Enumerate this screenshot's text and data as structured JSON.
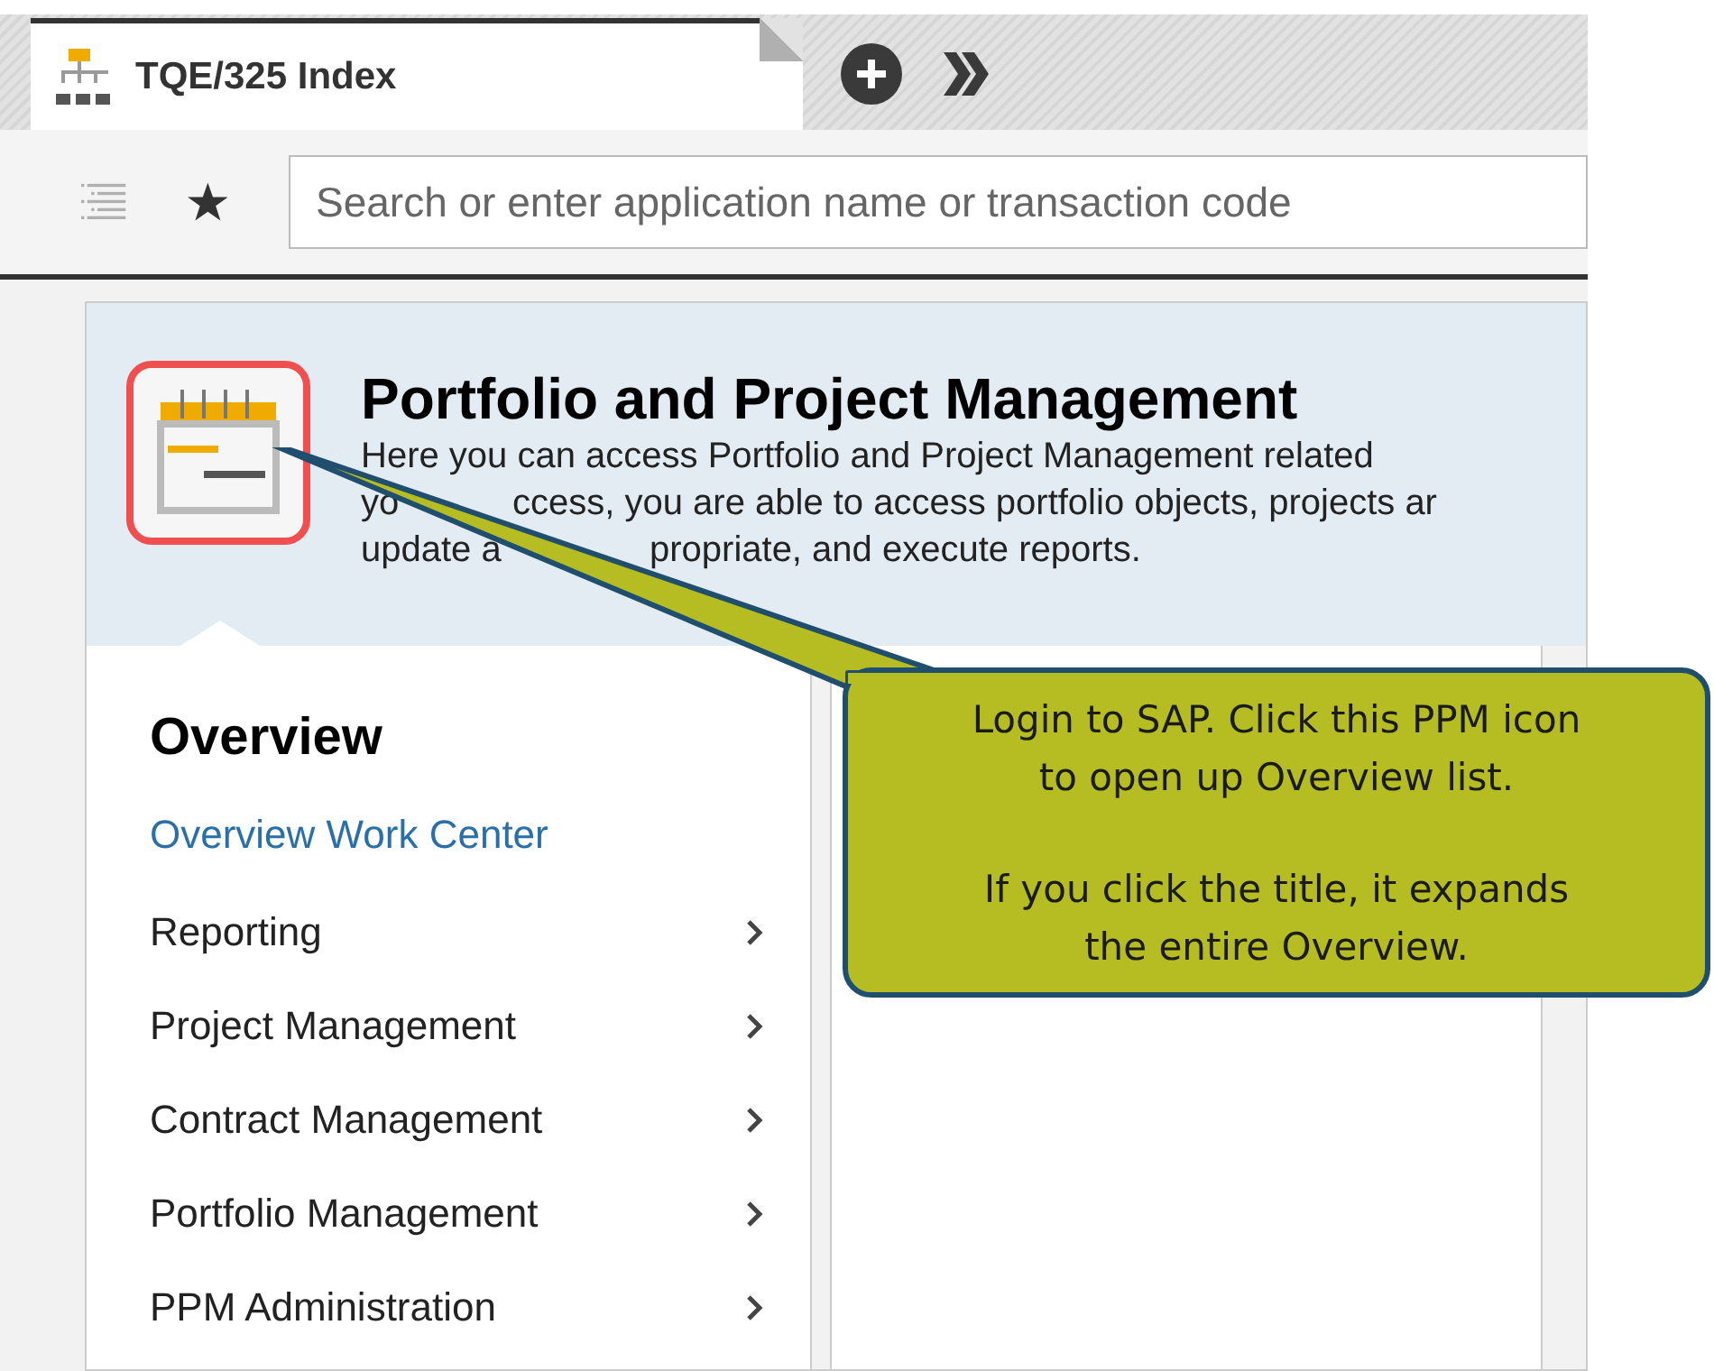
{
  "tab": {
    "title": "TQE/325 Index",
    "selected": true
  },
  "toolbar": {
    "search": {
      "placeholder": "Search or enter application name or transaction code"
    }
  },
  "header": {
    "title": "Portfolio and Project Management",
    "icon_highlighted": true,
    "description_lines": [
      [
        "Here you can access Portfolio and Project Management related"
      ],
      [
        "yo",
        "ccess, you are able to access portfolio objects, projects ar"
      ],
      [
        "update a",
        "propriate, and execute reports."
      ]
    ]
  },
  "menu": {
    "title": "Overview",
    "link": "Overview Work Center",
    "items": [
      {
        "label": "Reporting"
      },
      {
        "label": "Project Management"
      },
      {
        "label": "Contract Management"
      },
      {
        "label": "Portfolio Management"
      },
      {
        "label": "PPM Administration"
      }
    ]
  },
  "callout": {
    "paragraphs": [
      [
        "Login to SAP. Click this PPM icon",
        "to open up Overview list."
      ],
      [
        "If you click the title, it expands",
        "the entire Overview."
      ]
    ]
  }
}
